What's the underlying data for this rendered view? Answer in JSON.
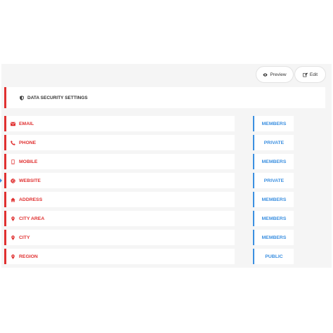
{
  "toolbar": {
    "preview_label": "Preview",
    "edit_label": "Edit"
  },
  "header": {
    "title": "DATA SECURITY SETTINGS"
  },
  "colors": {
    "field_accent": "#e03131",
    "privacy_accent": "#3b8fe0"
  },
  "rows": [
    {
      "label": "EMAIL",
      "icon": "envelope-icon",
      "privacy": "MEMBERS"
    },
    {
      "label": "PHONE",
      "icon": "phone-icon",
      "privacy": "PRIVATE"
    },
    {
      "label": "MOBILE",
      "icon": "mobile-icon",
      "privacy": "MEMBERS"
    },
    {
      "label": "WEBSITE",
      "icon": "globe-icon",
      "privacy": "PRIVATE"
    },
    {
      "label": "ADDRESS",
      "icon": "home-icon",
      "privacy": "MEMBERS"
    },
    {
      "label": "CITY AREA",
      "icon": "map-pin-icon",
      "privacy": "MEMBERS"
    },
    {
      "label": "CITY",
      "icon": "map-pin-icon",
      "privacy": "MEMBERS"
    },
    {
      "label": "REGION",
      "icon": "map-pin-icon",
      "privacy": "PUBLIC"
    }
  ]
}
